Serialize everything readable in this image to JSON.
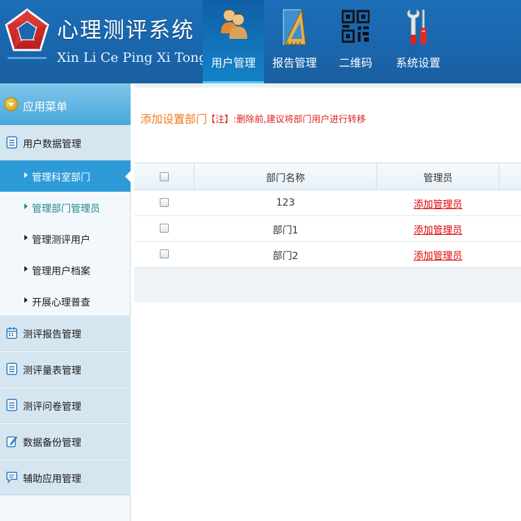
{
  "header": {
    "title_cn": "心理测评系统",
    "title_en": "Xin Li Ce Ping Xi Tong",
    "nav": [
      {
        "label": "用户管理",
        "icon": "users-icon",
        "active": true
      },
      {
        "label": "报告管理",
        "icon": "ruler-triangle-icon",
        "active": false
      },
      {
        "label": "二维码",
        "icon": "qr-code-icon",
        "active": false
      },
      {
        "label": "系统设置",
        "icon": "tools-icon",
        "active": false
      }
    ]
  },
  "sidebar": {
    "menu_title": "应用菜单",
    "groups": [
      {
        "label": "用户数据管理",
        "icon": "list-icon"
      },
      {
        "label": "测评报告管理",
        "icon": "calendar-icon"
      },
      {
        "label": "测评量表管理",
        "icon": "list-icon"
      },
      {
        "label": "测评问卷管理",
        "icon": "list-icon"
      },
      {
        "label": "数据备份管理",
        "icon": "edit-icon"
      },
      {
        "label": "辅助应用管理",
        "icon": "chat-icon"
      }
    ],
    "sub_items": [
      {
        "label": "管理科室部门",
        "active": true
      },
      {
        "label": "管理部门管理员",
        "active": false
      },
      {
        "label": "管理测评用户",
        "active": false
      },
      {
        "label": "管理用户档案",
        "active": false
      },
      {
        "label": "开展心理普查",
        "active": false
      }
    ]
  },
  "main": {
    "title": "添加设置部门",
    "note": "【注】:删除前,建议将部门用户进行转移",
    "table": {
      "headers": [
        "部门名称",
        "管理员"
      ],
      "rows": [
        {
          "name": "123",
          "admin": "添加管理员"
        },
        {
          "name": "部门1",
          "admin": "添加管理员"
        },
        {
          "name": "部门2",
          "admin": "添加管理员"
        }
      ]
    }
  },
  "colors": {
    "header_blue": "#1a66ad",
    "sidebar_active": "#2e9bd9",
    "title_orange": "#f07a1a",
    "note_red": "#e02020",
    "link_red": "#e00000"
  }
}
